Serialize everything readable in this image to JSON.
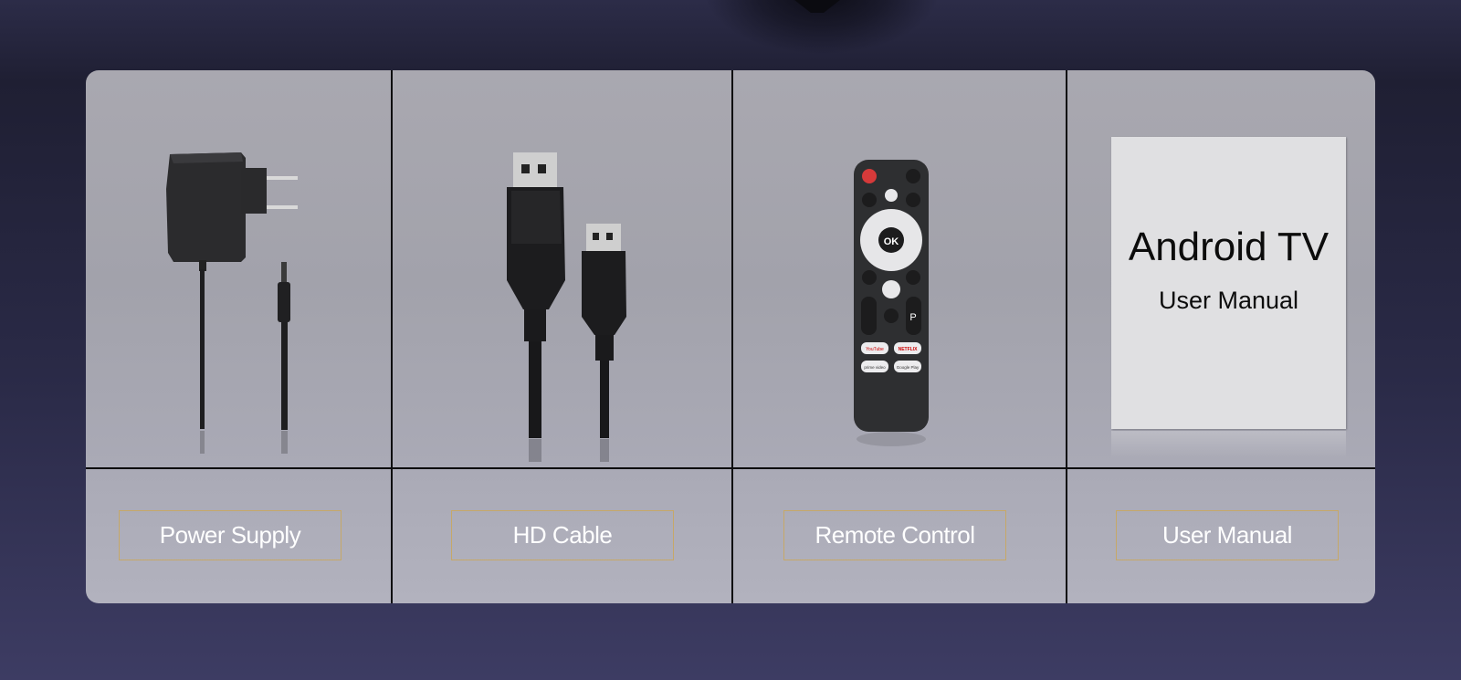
{
  "items": [
    {
      "label": "Power Supply"
    },
    {
      "label": "HD Cable"
    },
    {
      "label": "Remote Control"
    },
    {
      "label": "User Manual"
    }
  ],
  "manual": {
    "title": "Android TV",
    "subtitle": "User Manual"
  },
  "remote": {
    "ok_label": "OK",
    "p_label": "P",
    "apps": [
      "YouTube",
      "NETFLIX",
      "prime video",
      "Google Play"
    ]
  },
  "colors": {
    "label_border": "#c6a868",
    "panel": "#a9a8b0",
    "background": "#2a2a47"
  }
}
